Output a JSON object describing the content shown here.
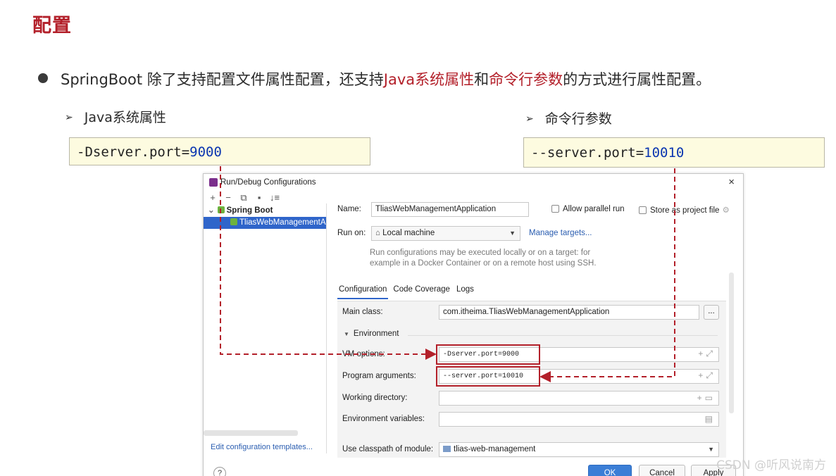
{
  "slide": {
    "title": "配置",
    "bullet_prefix": "SpringBoot 除了支持配置文件属性配置，还支持",
    "bullet_hl1": "Java系统属性",
    "bullet_mid": "和",
    "bullet_hl2": "命令行参数",
    "bullet_suffix": "的方式进行属性配置。",
    "arrow_glyph": "➢",
    "sub_left": "Java系统属性",
    "sub_right": "命令行参数",
    "code_left_prefix": "-Dserver.port=",
    "code_left_value": "9000",
    "code_right_prefix": "--server.port=",
    "code_right_value": "10010",
    "accent_color": "#b3202a"
  },
  "dialog": {
    "title": "Run/Debug Configurations",
    "close": "×",
    "toolbar": [
      "+",
      "−",
      "⧉",
      "▪",
      "↓≡"
    ],
    "tree": {
      "group_label": "Spring Boot",
      "selected_item": "TliasWebManagementA"
    },
    "edit_templates": "Edit configuration templates...",
    "help": "?",
    "name_label": "Name:",
    "name_value": "TliasWebManagementApplication",
    "allow_parallel": "Allow parallel run",
    "store_project": "Store as project file",
    "run_on_label": "Run on:",
    "run_on_value": "Local machine",
    "manage_targets": "Manage targets...",
    "hint_line1": "Run configurations may be executed locally or on a target: for",
    "hint_line2": "example in a Docker Container or on a remote host using SSH.",
    "tabs": [
      "Configuration",
      "Code Coverage",
      "Logs"
    ],
    "main_class_label": "Main class:",
    "main_class_value": "com.itheima.TliasWebManagementApplication",
    "browse_btn": "...",
    "environment_label": "Environment",
    "vm_label": "VM options:",
    "vm_value": "-Dserver.port=9000",
    "prog_label": "Program arguments:",
    "prog_value": "--server.port=10010",
    "workdir_label": "Working directory:",
    "envvars_label": "Environment variables:",
    "classpath_label": "Use classpath of module:",
    "classpath_value": "tlias-web-management",
    "ok": "OK",
    "cancel": "Cancel",
    "apply": "Apply"
  },
  "watermark": "CSDN @听风说南方"
}
